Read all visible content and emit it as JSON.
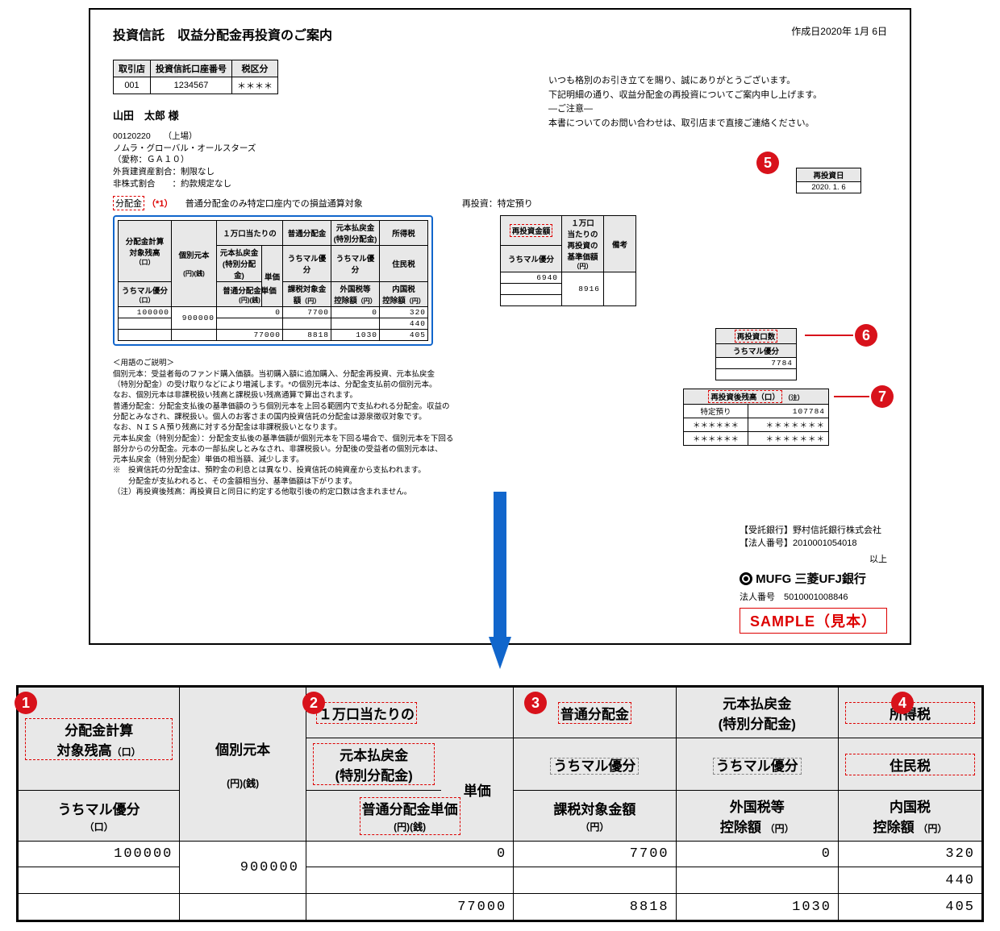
{
  "doc": {
    "title": "投資信託　収益分配金再投資のご案内",
    "date": "作成日2020年 1月 6日",
    "accountTable": {
      "h1": "取引店",
      "h2": "投資信託口座番号",
      "h3": "税区分",
      "v1": "001",
      "v2": "1234567",
      "v3": "＊＊＊＊"
    },
    "customer": "山田　太郎 様",
    "msg1": "いつも格別のお引き立てを賜り、誠にありがとうございます。",
    "msg2": "下記明細の通り、収益分配金の再投資についてご案内申し上げます。",
    "msg3": "―ご注意―",
    "msg4": "本書についてのお問い合わせは、取引店まで直接ご連絡ください。",
    "fund": {
      "code": "00120220　　（上場）",
      "name": "ノムラ・グローバル・オールスターズ",
      "alias": "（愛称：ＧＡ１０）",
      "note1": "外貨建資産割合：制限なし",
      "note2": "非株式割合　　：約款規定なし"
    },
    "dist": {
      "label": "分配金",
      "star": "（*1）",
      "note": "普通分配金のみ特定口座内での損益通算対象",
      "reinvType": "再投資：特定預り"
    },
    "reinvDate": {
      "h": "再投資日",
      "v": "2020. 1. 6"
    },
    "headers": {
      "c1a": "分配金計算",
      "c1b": "対象残高",
      "c1u": "（口）",
      "c1sub": "うちマル優分",
      "c1subU": "（口）",
      "c2": "個別元本",
      "c2u": "(円)(銭)",
      "c3top": "１万口当たりの",
      "c3a": "元本払戻金",
      "c3b": "(特別分配金)",
      "c3c": "単価",
      "c3d": "普通分配金単価",
      "c3u": "(円)(銭)",
      "c4a": "普通分配金",
      "c4sub": "うちマル優分",
      "c4b": "課税対象金額",
      "c4u": "（円）",
      "c5a": "元本払戻金",
      "c5b": "(特別分配金)",
      "c5sub": "うちマル優分",
      "c5c": "外国税等",
      "c5d": "控除額",
      "c5u": "（円）",
      "c6a": "所得税",
      "c6b": "住民税",
      "c6c": "内国税",
      "c6d": "控除額",
      "c6u": "（円）"
    },
    "vals": {
      "zan": "100000",
      "kobetsu": "900000",
      "tanka": "0",
      "futsu": "7700",
      "gaikoku": "0",
      "shotoku": "320",
      "tanka2": "77000",
      "kazei": "8818",
      "gaikoku2": "1030",
      "jumin": "440",
      "naikoku": "405"
    },
    "side": {
      "reinv_h": "再投資金額",
      "reinv_sub": "うちマル優分",
      "reinv_v": "6940",
      "base_h1": "１万口",
      "base_h2": "当たりの",
      "base_h3": "再投資の",
      "base_h4": "基準価額",
      "base_u": "（円）",
      "base_v": "8916",
      "biko": "備考",
      "units_h": "再投資口数",
      "units_sub": "うちマル優分",
      "units_v": "7784",
      "bal_h": "再投資後残高（口）",
      "bal_note": "（注）",
      "bal_l1": "特定預り",
      "bal_v1": "107784",
      "star": "＊＊＊＊＊＊",
      "star2": "＊＊＊＊＊＊＊"
    },
    "glossTitle": "＜用語のご説明＞",
    "gloss1": "個別元本：受益者毎のファンド購入価額。当初購入額に追加購入、分配金再投資、元本払戻金",
    "gloss2": "（特別分配金）の受け取りなどにより増減します。*の個別元本は、分配金支払前の個別元本。",
    "gloss3": "なお、個別元本は非課税扱い残高と課税扱い残高通算で算出されます。",
    "gloss4": "普通分配金：分配金支払後の基準価額のうち個別元本を上回る範囲内で支払われる分配金。収益の",
    "gloss5": "分配とみなされ、課税扱い。個人のお客さまの国内投資信託の分配金は源泉徴収対象です。",
    "gloss6": "なお、ＮＩＳＡ預り残高に対する分配金は非課税扱いとなります。",
    "gloss7": "元本払戻金（特別分配金）：分配金支払後の基準価額が個別元本を下回る場合で、個別元本を下回る",
    "gloss8": "部分からの分配金。元本の一部払戻しとみなされ、非課税扱い。分配後の受益者の個別元本は、",
    "gloss9": "元本払戻金（特別分配金）単価の相当額、減少します。",
    "gloss10": "※　投資信託の分配金は、預貯金の利息とは異なり、投資信託の純資産から支払われます。",
    "gloss11": "　　分配金が支払われると、その金額相当分、基準価額は下がります。",
    "gloss12": "（注）再投資後残高：再投資日と同日に約定する他取引後の約定口数は含まれません。",
    "trust": "【受託銀行】野村信託銀行株式会社",
    "corpNo1": "【法人番号】2010001054018",
    "end": "以上",
    "mufg": "MUFG 三菱UFJ銀行",
    "corpNo2": "法人番号　5010001008846",
    "sample": "SAMPLE（見本）"
  },
  "badges": {
    "b1": "1",
    "b2": "2",
    "b3": "3",
    "b4": "4",
    "b5": "5",
    "b6": "6",
    "b7": "7"
  }
}
